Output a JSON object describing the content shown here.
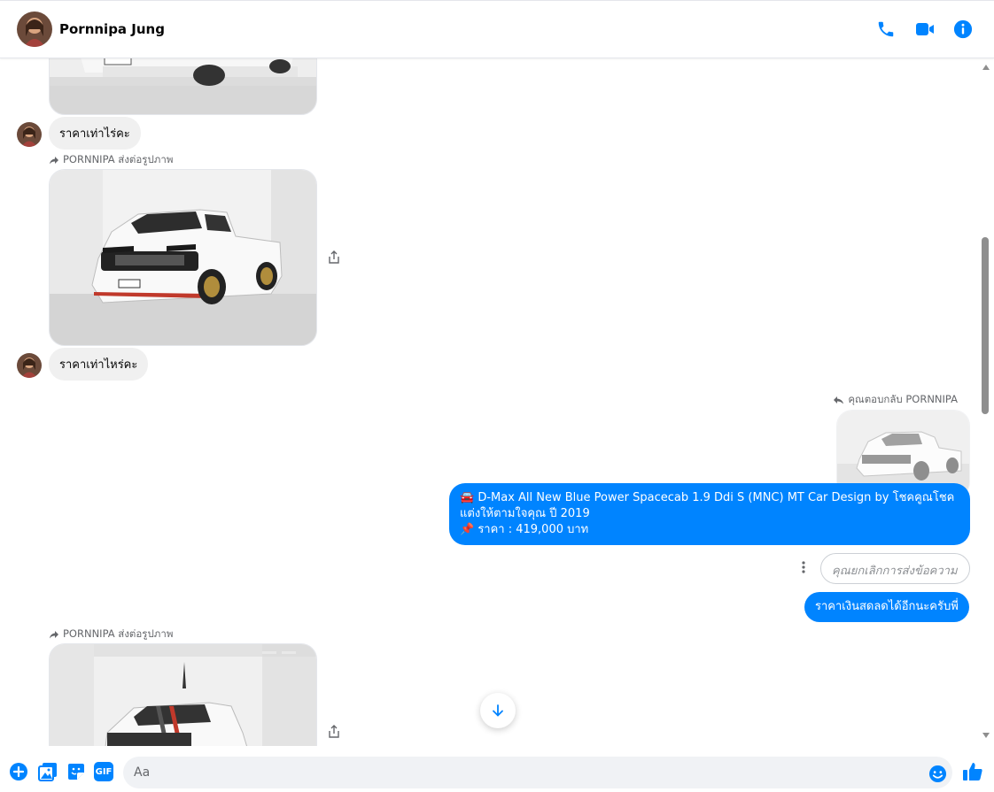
{
  "header": {
    "contact_name": "Pornnipa Jung",
    "icons": [
      "phone-icon",
      "video-icon",
      "info-icon"
    ]
  },
  "colors": {
    "accent": "#0084ff",
    "incoming_bubble": "#f0f0f0"
  },
  "messages": {
    "incoming_1": "ราคาเท่าไร่คะ",
    "forward_label_1": "PORNNIPA ส่งต่อรูปภาพ",
    "incoming_2": "ราคาเท่าไหร่คะ",
    "reply_label": "คุณตอบกลับ PORNNIPA",
    "outgoing_line_1": "🚘 D-Max All New Blue Power Spacecab 1.9 Ddi S (MNC) MT Car Design by โชคคูณโชค แต่งให้ตามใจคุณ ปี 2019",
    "outgoing_line_2": "📌 ราคา : 419,000 บาท",
    "unsent_notice": "คุณยกเลิกการส่งข้อความ",
    "outgoing_2": "ราคาเงินสดลดได้อีกนะครับพี่",
    "forward_label_2": "PORNNIPA ส่งต่อรูปภาพ"
  },
  "composer": {
    "placeholder": "Aa",
    "icons": [
      "plus-icon",
      "gallery-icon",
      "sticker-icon",
      "gif-icon",
      "emoji-icon",
      "like-icon"
    ],
    "gif_label": "GIF"
  }
}
